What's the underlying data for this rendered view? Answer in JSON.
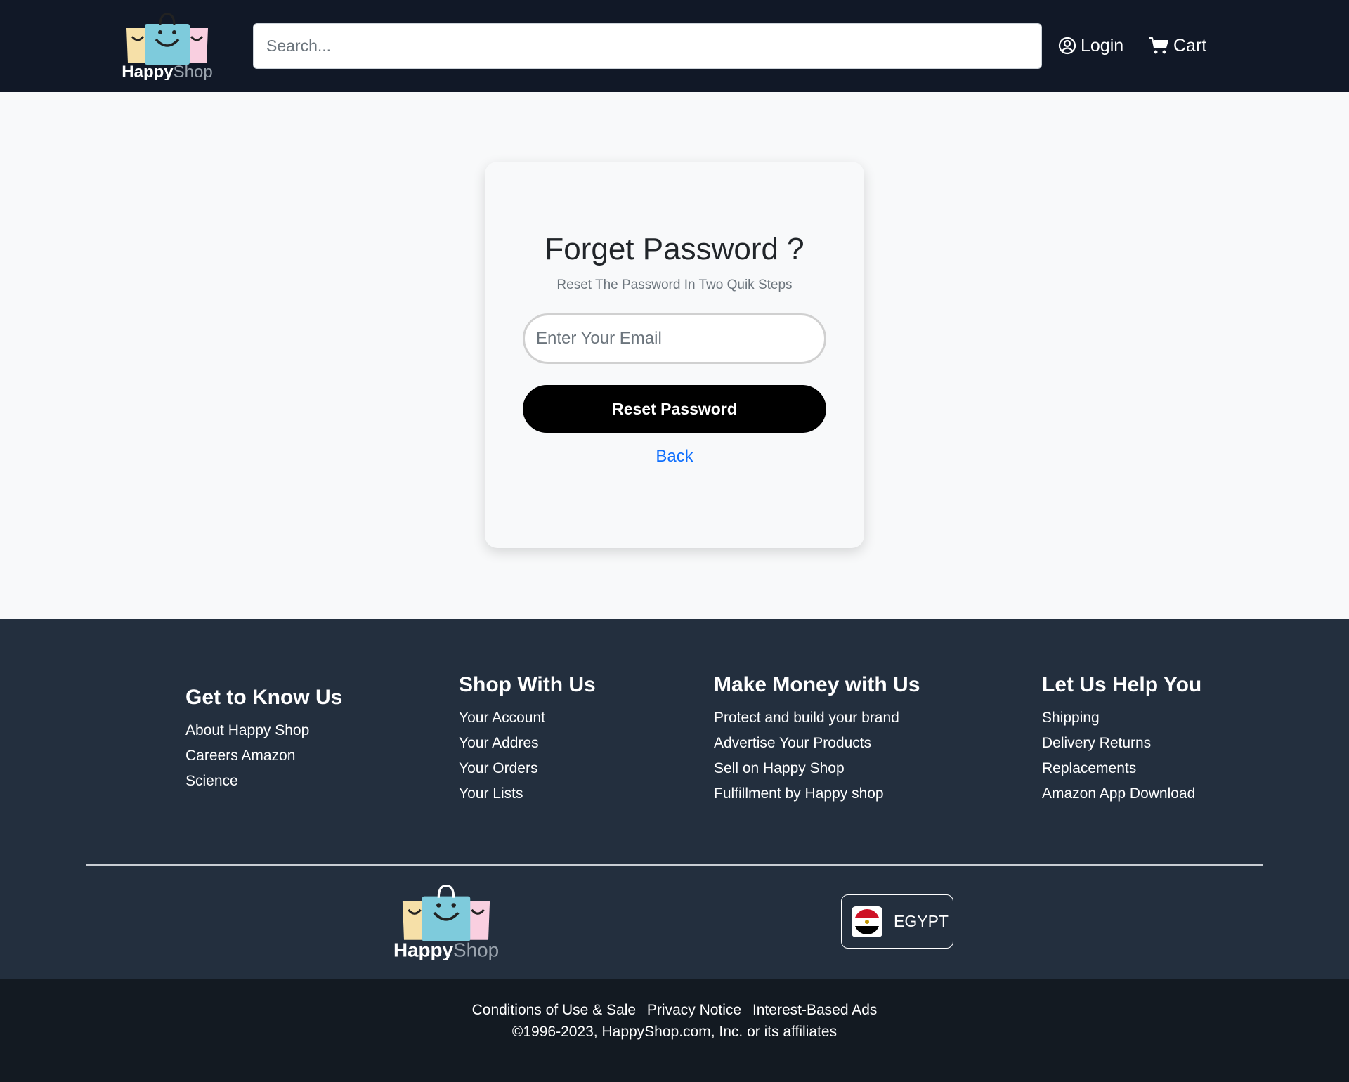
{
  "brand": {
    "name_part1": "Happy",
    "name_part2": "Shop"
  },
  "header": {
    "search_placeholder": "Search...",
    "login_label": "Login",
    "cart_label": "Cart"
  },
  "card": {
    "title": "Forget Password ?",
    "subtitle": "Reset The Password In Two Quik Steps",
    "email_placeholder": "Enter Your Email",
    "reset_button": "Reset Password",
    "back_link": "Back"
  },
  "footer": {
    "columns": [
      {
        "title": "Get to Know Us",
        "links": [
          "About Happy Shop",
          "Careers Amazon",
          "Science"
        ]
      },
      {
        "title": "Shop With Us",
        "links": [
          "Your Account",
          "Your Addres",
          "Your Orders",
          "Your Lists"
        ]
      },
      {
        "title": "Make Money with Us",
        "links": [
          "Protect and build your brand",
          "Advertise Your Products",
          "Sell on Happy Shop",
          "Fulfillment by Happy shop"
        ]
      },
      {
        "title": "Let Us Help You",
        "links": [
          "Shipping",
          "Delivery Returns",
          "Replacements",
          "Amazon App Download"
        ]
      }
    ],
    "country": "EGYPT",
    "legal_links": [
      "Conditions of Use & Sale",
      "Privacy Notice",
      "Interest-Based Ads"
    ],
    "copyright": "©1996-2023, HappyShop.com, Inc. or its affiliates"
  },
  "icons": {
    "login": "user-circle-icon",
    "cart": "shopping-cart-icon",
    "flag": "egypt-flag-icon"
  },
  "colors": {
    "header_bg": "#111827",
    "footer_bg": "#232f3e",
    "bottom_bar_bg": "#131a22",
    "link_blue": "#0d6efd",
    "button_black": "#000000",
    "bag_yellow": "#f6e0a8",
    "bag_blue": "#7ecbdc",
    "bag_pink": "#f9cfe0"
  }
}
